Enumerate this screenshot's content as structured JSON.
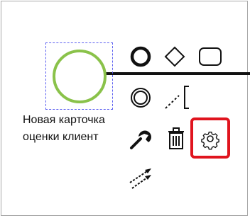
{
  "element": {
    "type": "start-event",
    "label_lines": [
      "Новая карточка",
      "оценки клиент"
    ],
    "stroke_color": "#8ac24a",
    "selection_color": "#5a5ef0"
  },
  "context_pad": [
    {
      "name": "append-end-event-icon",
      "title": ""
    },
    {
      "name": "append-gateway-icon",
      "title": ""
    },
    {
      "name": "append-task-icon",
      "title": ""
    },
    {
      "name": "append-intermediate-event-icon",
      "title": ""
    },
    {
      "name": "append-text-annotation-icon",
      "title": ""
    },
    {
      "name": "change-type-wrench-icon",
      "title": ""
    },
    {
      "name": "delete-trash-icon",
      "title": ""
    },
    {
      "name": "settings-gear-icon",
      "title": ""
    },
    {
      "name": "connect-arrows-icon",
      "title": ""
    }
  ],
  "highlight": {
    "target": "settings-gear-icon",
    "color": "#e0141e"
  }
}
